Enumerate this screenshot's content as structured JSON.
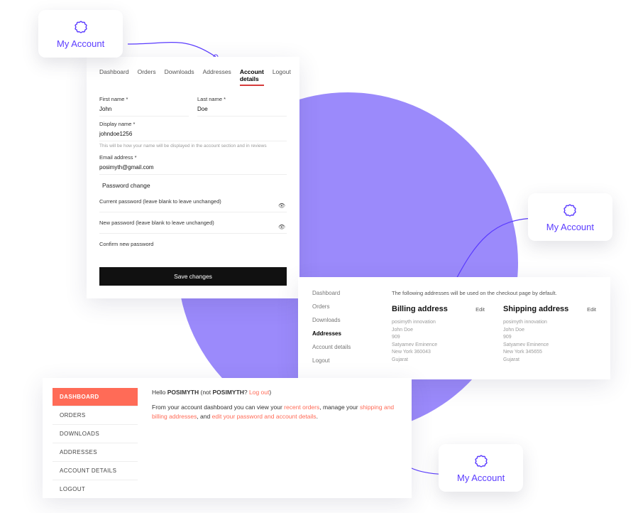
{
  "colors": {
    "accent": "#5B3CFF",
    "bgCircle": "#9B8AFB",
    "formTabUnderline": "#d63b3b",
    "dashAccent": "#FF6B57"
  },
  "callout": {
    "label": "My Account",
    "iconName": "cog-badge-icon"
  },
  "accountPanel": {
    "tabs": [
      "Dashboard",
      "Orders",
      "Downloads",
      "Addresses",
      "Account details",
      "Logout"
    ],
    "activeTab": "Account details",
    "firstNameLabel": "First name *",
    "firstName": "John",
    "lastNameLabel": "Last name *",
    "lastName": "Doe",
    "displayNameLabel": "Display name *",
    "displayName": "johndoe1256",
    "displayHelp": "This will be how your name will be displayed in the account section and in reviews",
    "emailLabel": "Email address *",
    "email": "posimyth@gmail.com",
    "passwordChangeTitle": "Password change",
    "currentPassword": "Current password (leave blank to leave unchanged)",
    "newPassword": "New password (leave blank to leave unchanged)",
    "confirmPassword": "Confirm new password",
    "saveLabel": "Save changes"
  },
  "addressesPanel": {
    "nav": [
      "Dashboard",
      "Orders",
      "Downloads",
      "Addresses",
      "Account details",
      "Logout"
    ],
    "activeNav": "Addresses",
    "intro": "The following addresses will be used on the checkout page by default.",
    "editLabel": "Edit",
    "billing": {
      "title": "Billing address",
      "lines": [
        "posimyth innovation",
        "John Doe",
        "909",
        "Satyamev Eminence",
        "New York 360043",
        "Gujarat"
      ]
    },
    "shipping": {
      "title": "Shipping address",
      "lines": [
        "posimyth innovation",
        "John Doe",
        "909",
        "Satyamev Eminence",
        "New York 345655",
        "Gujarat"
      ]
    }
  },
  "dashboardPanel": {
    "nav": [
      "DASHBOARD",
      "ORDERS",
      "DOWNLOADS",
      "ADDRESSES",
      "ACCOUNT DETAILS",
      "LOGOUT"
    ],
    "activeNav": "DASHBOARD",
    "hello_pre": "Hello ",
    "user": "POSIMYTH",
    "not_pre": " (not ",
    "not_user": "POSIMYTH",
    "logout_link": "Log out",
    "close_paren": ")",
    "body_pre": "From your account dashboard you can view your ",
    "recent_orders": "recent orders",
    "body_mid1": ", manage your ",
    "shipping_billing": "shipping and billing addresses",
    "body_mid2": ", and ",
    "edit_pw": "edit your password and account details",
    "body_end": "."
  }
}
